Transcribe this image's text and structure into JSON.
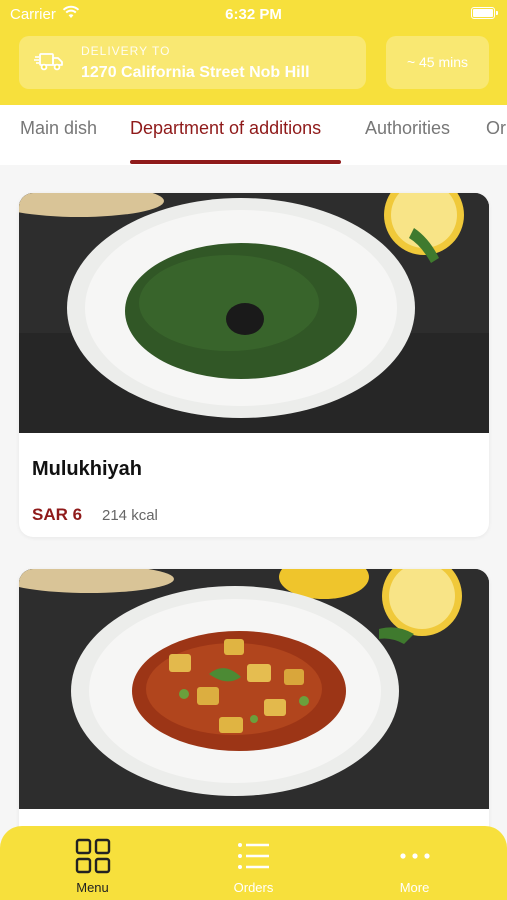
{
  "status_bar": {
    "carrier": "Carrier",
    "time": "6:32 PM"
  },
  "header": {
    "delivery_label": "DELIVERY TO",
    "delivery_address": "1270 California Street Nob Hill",
    "eta": "~ 45 mins"
  },
  "categories": {
    "tabs": [
      {
        "label": "Main dish"
      },
      {
        "label": "Department of additions"
      },
      {
        "label": "Authorities"
      },
      {
        "label": "Or"
      }
    ],
    "selected": "Department of additions"
  },
  "products": [
    {
      "name": "Mulukhiyah",
      "price": "SAR 6",
      "calories": "214 kcal"
    },
    {
      "name": "",
      "price": "",
      "calories": ""
    }
  ],
  "bottom_nav": {
    "items": [
      {
        "label": "Menu",
        "icon": "grid-icon"
      },
      {
        "label": "Orders",
        "icon": "list-icon"
      },
      {
        "label": "More",
        "icon": "more-dots-icon"
      }
    ],
    "active": "Menu"
  },
  "colors": {
    "brand_yellow": "#f7e03c",
    "accent_red": "#8f1a1a"
  }
}
